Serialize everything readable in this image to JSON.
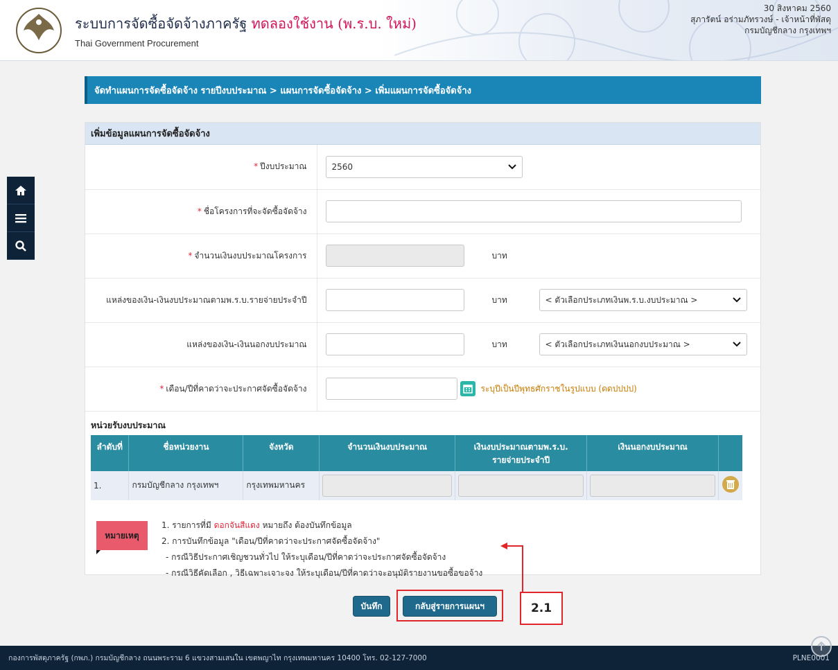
{
  "header": {
    "title_main": "ระบบการจัดซื้อจัดจ้างภาครัฐ",
    "title_trial": "ทดลองใช้งาน (พ.ร.บ. ใหม่)",
    "subtitle": "Thai Government Procurement",
    "date": "30 สิงหาคม 2560",
    "user": "สุภารัตน์ อร่ามภัทรวงษ์ - เจ้าหน้าที่พัสดุ",
    "department": "กรมบัญชีกลาง กรุงเทพฯ"
  },
  "sidenav": {
    "items": [
      {
        "icon": "home-icon"
      },
      {
        "icon": "menu-icon"
      },
      {
        "icon": "search-icon"
      }
    ]
  },
  "breadcrumb": "จัดทำแผนการจัดซื้อจัดจ้าง รายปีงบประมาณ > แผนการจัดซื้อจัดจ้าง > เพิ่มแผนการจัดซื้อจัดจ้าง",
  "form": {
    "section_title": "เพิ่มข้อมูลแผนการจัดซื้อจัดจ้าง",
    "fiscal_year": {
      "label": "ปีงบประมาณ",
      "value": "2560"
    },
    "project_name": {
      "label": "ชื่อโครงการที่จะจัดซื้อจัดจ้าง",
      "value": ""
    },
    "budget_amount": {
      "label": "จำนวนเงินงบประมาณโครงการ",
      "unit": "บาท"
    },
    "annual_budget_source": {
      "label": "แหล่งของเงิน-เงินงบประมาณตามพ.ร.บ.รายจ่ายประจำปี",
      "unit": "บาท",
      "select": "< ตัวเลือกประเภทเงินพ.ร.บ.งบประมาณ >"
    },
    "off_budget_source": {
      "label": "แหล่งของเงิน-เงินนอกงบประมาณ",
      "unit": "บาท",
      "select": "< ตัวเลือกประเภทเงินนอกงบประมาณ >"
    },
    "announce_month": {
      "label": "เดือน/ปีที่คาดว่าจะประกาศจัดซื้อจัดจ้าง",
      "hint": "ระบุปีเป็นปีพุทธศักราชในรูปแบบ (ดดปปปป)"
    }
  },
  "budget_units": {
    "title": "หน่วยรับงบประมาณ",
    "columns": [
      "ลำดับที่",
      "ชื่อหน่วยงาน",
      "จังหวัด",
      "จำนวนเงินงบประมาณ",
      "เงินงบประมาณตามพ.ร.บ.",
      "รายจ่ายประจำปี",
      "เงินนอกงบประมาณ"
    ],
    "rows": [
      {
        "no": "1.",
        "agency": "กรมบัญชีกลาง กรุงเทพฯ",
        "province": "กรุงเทพมหานคร"
      }
    ]
  },
  "notes": {
    "badge": "หมายเหตุ",
    "line1_a": "1. รายการที่มี ",
    "line1_b": "ดอกจันสีแดง",
    "line1_c": " หมายถึง ต้องบันทึกข้อมูล",
    "line2": "2. การบันทึกข้อมูล \"เดือน/ปีที่คาดว่าจะประกาศจัดซื้อจัดจ้าง\"",
    "line3": "- กรณีวิธีประกาศเชิญชวนทั่วไป ให้ระบุเดือน/ปีที่คาดว่าจะประกาศจัดซื้อจัดจ้าง",
    "line4": "- กรณีวิธีคัดเลือก , วิธีเฉพาะเจาะจง ให้ระบุเดือน/ปีที่คาดว่าจะอนุมัติรายงานขอซื้อขอจ้าง"
  },
  "buttons": {
    "save": "บันทึก",
    "back": "กลับสู่รายการแผนฯ"
  },
  "callout": "2.1",
  "footer": {
    "address": "กองการพัสดุภาครัฐ (กพภ.) กรมบัญชีกลาง ถนนพระราม 6 แขวงสามเสนใน เขตพญาไท กรุงเทพมหานคร 10400 โทร. 02-127-7000",
    "code": "PLNE0001"
  },
  "colors": {
    "primary": "#1a86b8",
    "table_header": "#2a8ca0",
    "required": "#e0263a",
    "button": "#1f6a8c",
    "footer": "#0e2238"
  }
}
